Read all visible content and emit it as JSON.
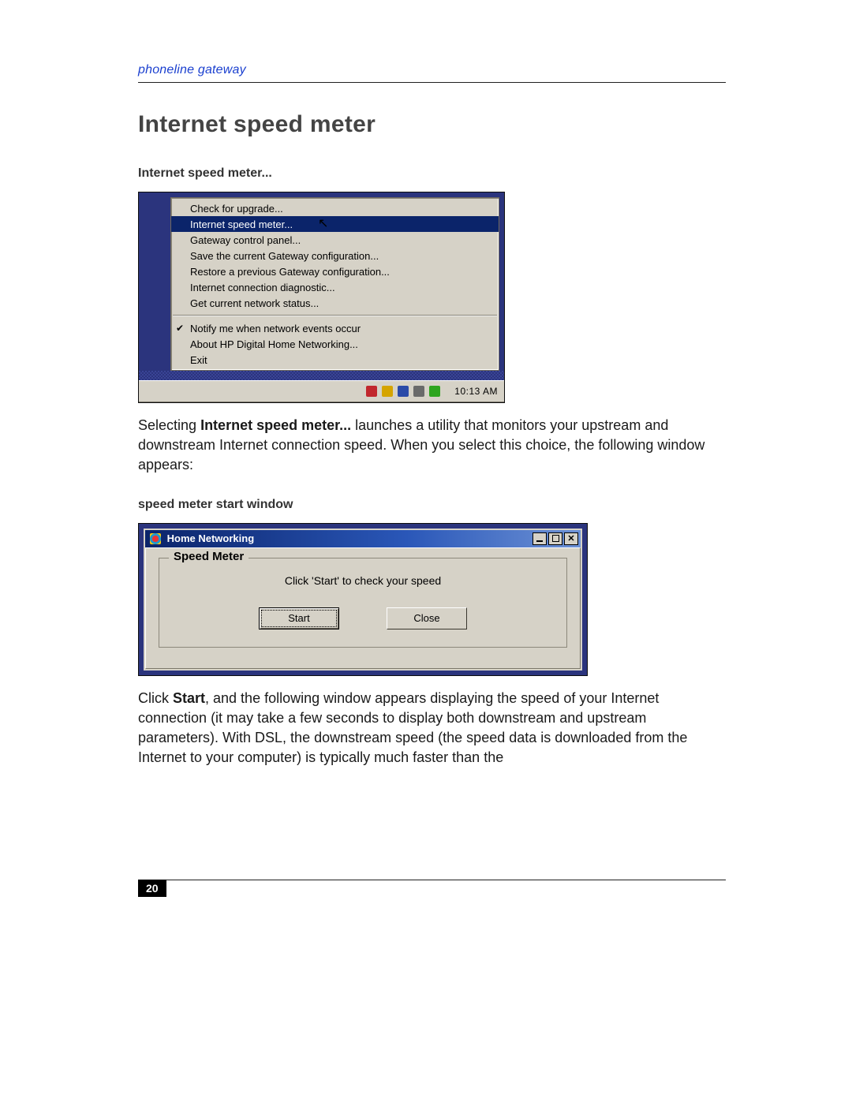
{
  "header": {
    "running_head": "phoneline gateway"
  },
  "title": "Internet speed meter",
  "figure1": {
    "caption": "Internet speed meter...",
    "menu": {
      "group1": [
        "Check for upgrade...",
        "Internet speed meter...",
        "Gateway control panel...",
        "Save the current Gateway configuration...",
        "Restore a previous Gateway configuration...",
        "Internet connection diagnostic...",
        "Get current network status..."
      ],
      "selected_index": 1,
      "group2": [
        "Notify me when network events occur",
        "About HP Digital Home Networking...",
        "Exit"
      ],
      "checked_index_g2": 0
    },
    "taskbar": {
      "clock": "10:13 AM"
    }
  },
  "para1": {
    "pre": "Selecting ",
    "bold": "Internet speed meter...",
    "post": " launches a utility that monitors your upstream and downstream Internet connection speed. When you select this choice, the following window appears:"
  },
  "figure2": {
    "caption": "speed meter start window",
    "window": {
      "title": "Home Networking",
      "groupbox": "Speed Meter",
      "prompt": "Click 'Start' to check your speed",
      "buttons": {
        "start": "Start",
        "close": "Close"
      }
    }
  },
  "para2": {
    "pre": "Click ",
    "bold": "Start",
    "post": ", and the following window appears displaying the speed of your Internet connection (it may take a few seconds to display both downstream and upstream parameters). With DSL, the downstream speed (the speed data is downloaded from the Internet to your computer) is typically much faster than the"
  },
  "page_number": "20"
}
